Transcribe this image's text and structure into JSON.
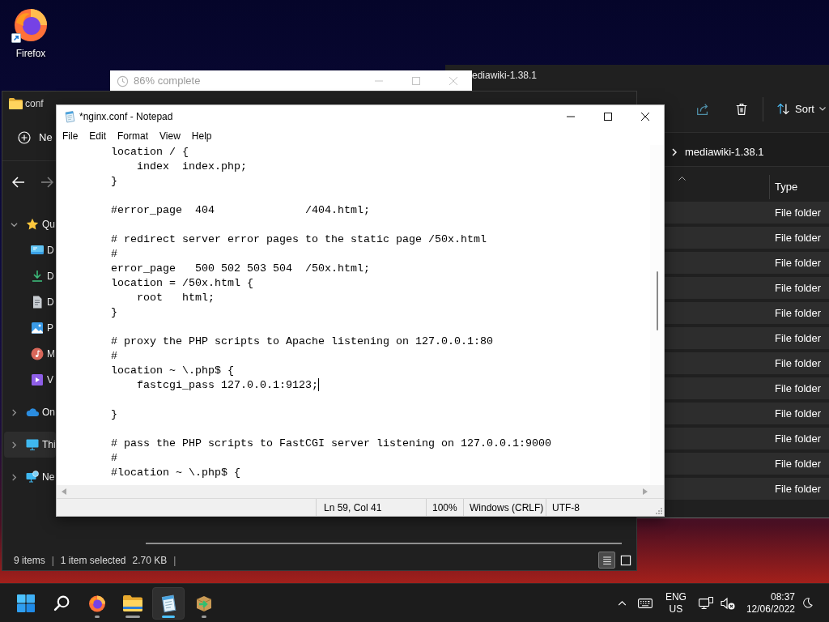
{
  "desktop": {
    "shortcuts": [
      {
        "label": "Firefox"
      }
    ]
  },
  "explorer_back": {
    "title": "ediawiki-1.38.1",
    "sort_label": "Sort",
    "address": "mediawiki-1.38.1",
    "columns": [
      "Type"
    ],
    "rows": [
      {
        "type": "File folder",
        "selected": true
      },
      {
        "type": "File folder",
        "selected": true
      },
      {
        "type": "File folder",
        "selected": true
      },
      {
        "type": "File folder",
        "selected": true
      },
      {
        "type": "File folder",
        "selected": true
      },
      {
        "type": "File folder",
        "selected": true
      },
      {
        "type": "File folder",
        "selected": true
      },
      {
        "type": "File folder",
        "selected": true
      },
      {
        "type": "File folder",
        "selected": true
      },
      {
        "type": "File folder",
        "selected": true
      },
      {
        "type": "File folder",
        "selected": true
      },
      {
        "type": "File folder",
        "selected": true
      }
    ]
  },
  "progress_dialog": {
    "title": "86% complete"
  },
  "explorer_front": {
    "title": "conf",
    "new_label": "Ne",
    "sidebar": [
      {
        "kind": "star",
        "label": "Qu",
        "expanded": true,
        "selected": false,
        "children": [
          {
            "kind": "desktop",
            "label": "D",
            "selected": false
          },
          {
            "kind": "downloads",
            "label": "D",
            "selected": false
          },
          {
            "kind": "documents",
            "label": "D",
            "selected": false
          },
          {
            "kind": "pictures",
            "label": "P",
            "selected": false
          },
          {
            "kind": "music",
            "label": "M",
            "selected": false
          },
          {
            "kind": "videos",
            "label": "V",
            "selected": false
          }
        ]
      },
      {
        "kind": "cloud",
        "label": "On",
        "expanded": false,
        "selected": false
      },
      {
        "kind": "computer",
        "label": "Thi",
        "expanded": false,
        "selected": true
      },
      {
        "kind": "network",
        "label": "Ne",
        "expanded": false,
        "selected": false
      }
    ],
    "status_bar": [
      {
        "kind": "text",
        "text": "9 items"
      },
      {
        "kind": "separator",
        "text": "|"
      },
      {
        "kind": "text",
        "text": "1 item selected"
      },
      {
        "kind": "text",
        "text": "2.70 KB"
      },
      {
        "kind": "separator",
        "text": "|"
      }
    ],
    "view_buttons": [
      {
        "kind": "details",
        "selected": true
      },
      {
        "kind": "tiles",
        "selected": false
      }
    ]
  },
  "notepad": {
    "title": "*nginx.conf - Notepad",
    "menu": [
      "File",
      "Edit",
      "Format",
      "View",
      "Help"
    ],
    "lines": [
      {
        "kind": "code",
        "text": "        location / {",
        "caret": false
      },
      {
        "kind": "code",
        "text": "            index  index.php;",
        "caret": false
      },
      {
        "kind": "code",
        "text": "        }",
        "caret": false
      },
      {
        "kind": "blank"
      },
      {
        "kind": "code",
        "text": "        #error_page  404              /404.html;",
        "caret": false
      },
      {
        "kind": "blank"
      },
      {
        "kind": "code",
        "text": "        # redirect server error pages to the static page /50x.html",
        "caret": false
      },
      {
        "kind": "code",
        "text": "        #",
        "caret": false
      },
      {
        "kind": "code",
        "text": "        error_page   500 502 503 504  /50x.html;",
        "caret": false
      },
      {
        "kind": "code",
        "text": "        location = /50x.html {",
        "caret": false
      },
      {
        "kind": "code",
        "text": "            root   html;",
        "caret": false
      },
      {
        "kind": "code",
        "text": "        }",
        "caret": false
      },
      {
        "kind": "blank"
      },
      {
        "kind": "code",
        "text": "        # proxy the PHP scripts to Apache listening on 127.0.0.1:80",
        "caret": false
      },
      {
        "kind": "code",
        "text": "        #",
        "caret": false
      },
      {
        "kind": "code",
        "text": "        location ~ \\.php$ {",
        "caret": false
      },
      {
        "kind": "code",
        "text": "            fastcgi_pass 127.0.0.1:9123;",
        "caret": true
      },
      {
        "kind": "blank"
      },
      {
        "kind": "code",
        "text": "        }",
        "caret": false
      },
      {
        "kind": "blank"
      },
      {
        "kind": "code",
        "text": "        # pass the PHP scripts to FastCGI server listening on 127.0.0.1:9000",
        "caret": false
      },
      {
        "kind": "code",
        "text": "        #",
        "caret": false
      },
      {
        "kind": "code",
        "text": "        #location ~ \\.php$ {",
        "caret": false
      }
    ],
    "status": {
      "position": "Ln 59, Col 41",
      "zoom": "100%",
      "line_ending": "Windows (CRLF)",
      "encoding": "UTF-8"
    }
  },
  "taskbar": {
    "apps": [
      {
        "kind": "browser",
        "running": true,
        "active": false,
        "several_windows": false
      },
      {
        "kind": "files",
        "running": true,
        "active": false,
        "several_windows": true
      },
      {
        "kind": "notepad",
        "running": true,
        "active": true,
        "several_windows": false
      },
      {
        "kind": "installer",
        "running": true,
        "active": false,
        "several_windows": false
      }
    ],
    "language": "ENG",
    "region": "US",
    "time": "08:37",
    "date": "12/06/2022"
  }
}
